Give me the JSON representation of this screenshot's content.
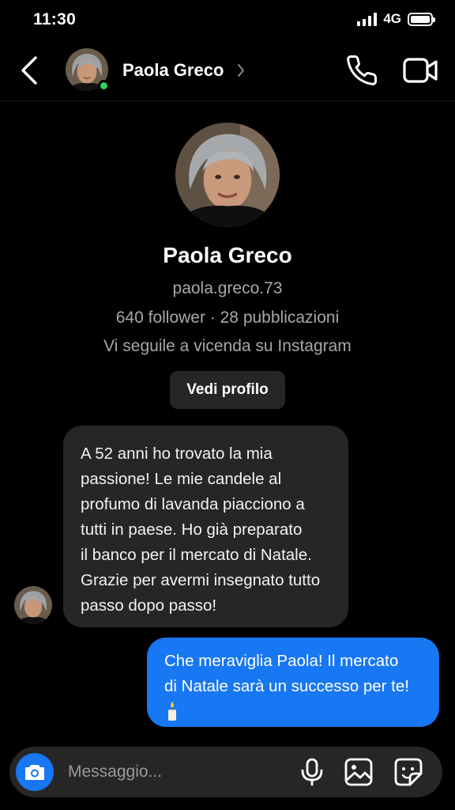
{
  "status_bar": {
    "time": "11:30",
    "network": "4G",
    "battery_level": 1.0,
    "signal_bars": 4
  },
  "header": {
    "contact_name": "Paola Greco",
    "online": true,
    "icons": [
      "back-arrow-icon",
      "chevron-right-icon",
      "phone-icon",
      "video-camera-icon"
    ]
  },
  "profile": {
    "name": "Paola Greco",
    "username": "paola.greco.73",
    "stats": "640 follower · 28 pubblicazioni",
    "mutual": "Vi seguile a vicenda su Instagram",
    "view_profile_label": "Vedi profilo"
  },
  "messages": [
    {
      "direction": "incoming",
      "lines": [
        "A 52 anni ho trovato la mia",
        "passione! Le mie candele al",
        "profumo di lavanda piacciono a",
        "tutti in paese. Ho già preparato",
        "il banco per il mercato di Natale.",
        "Grazie per avermi insegnato tutto",
        "passo dopo passo!"
      ]
    },
    {
      "direction": "outgoing",
      "lines": [
        "Che meraviglia Paola! Il mercato",
        "di Natale sarà un successo per te!"
      ],
      "emoji": "candle-emoji"
    }
  ],
  "composer": {
    "placeholder": "Messaggio...",
    "icons": [
      "camera-icon",
      "microphone-icon",
      "gallery-icon",
      "sticker-icon"
    ]
  },
  "colors": {
    "background": "#000000",
    "incoming_bubble": "#262626",
    "outgoing_bubble": "#1877f2",
    "online_dot": "#2fd25b",
    "secondary_text": "#a8a8a8"
  }
}
